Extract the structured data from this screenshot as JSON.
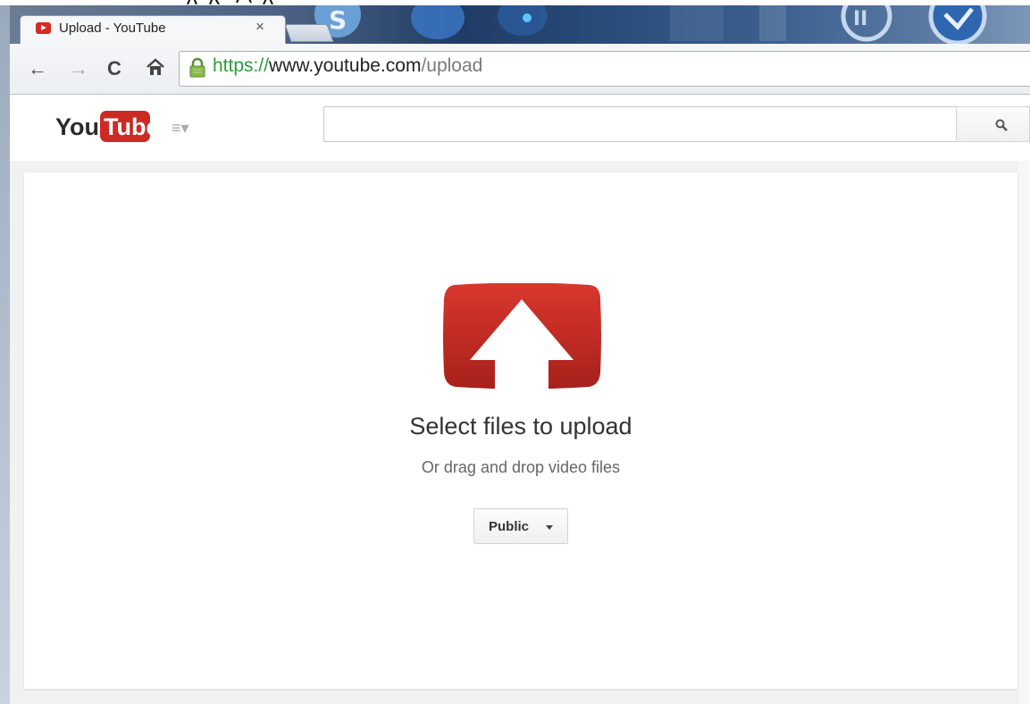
{
  "browser": {
    "tab": {
      "title": "Upload - YouTube",
      "close_glyph": "×",
      "favicon": "youtube-favicon-icon"
    },
    "nav": {
      "back": "←",
      "forward": "→",
      "reload": "C",
      "home": "home-icon"
    },
    "address_bar": {
      "scheme": "https://",
      "host": "www.youtube.com",
      "path": "/upload",
      "lock": "lock-icon"
    }
  },
  "header": {
    "logo_you": "You",
    "logo_tube": "Tube",
    "guide_glyph": "≡▾",
    "search": {
      "value": "",
      "placeholder": "",
      "button_icon": "search-icon"
    }
  },
  "upload": {
    "title": "Select files to upload",
    "subtitle": "Or drag and drop video files",
    "privacy": {
      "selected": "Public"
    }
  },
  "colors": {
    "brand_red": "#cc2b24",
    "secure_green": "#2a9d3a",
    "text_dark": "#333333",
    "text_muted": "#666666"
  }
}
